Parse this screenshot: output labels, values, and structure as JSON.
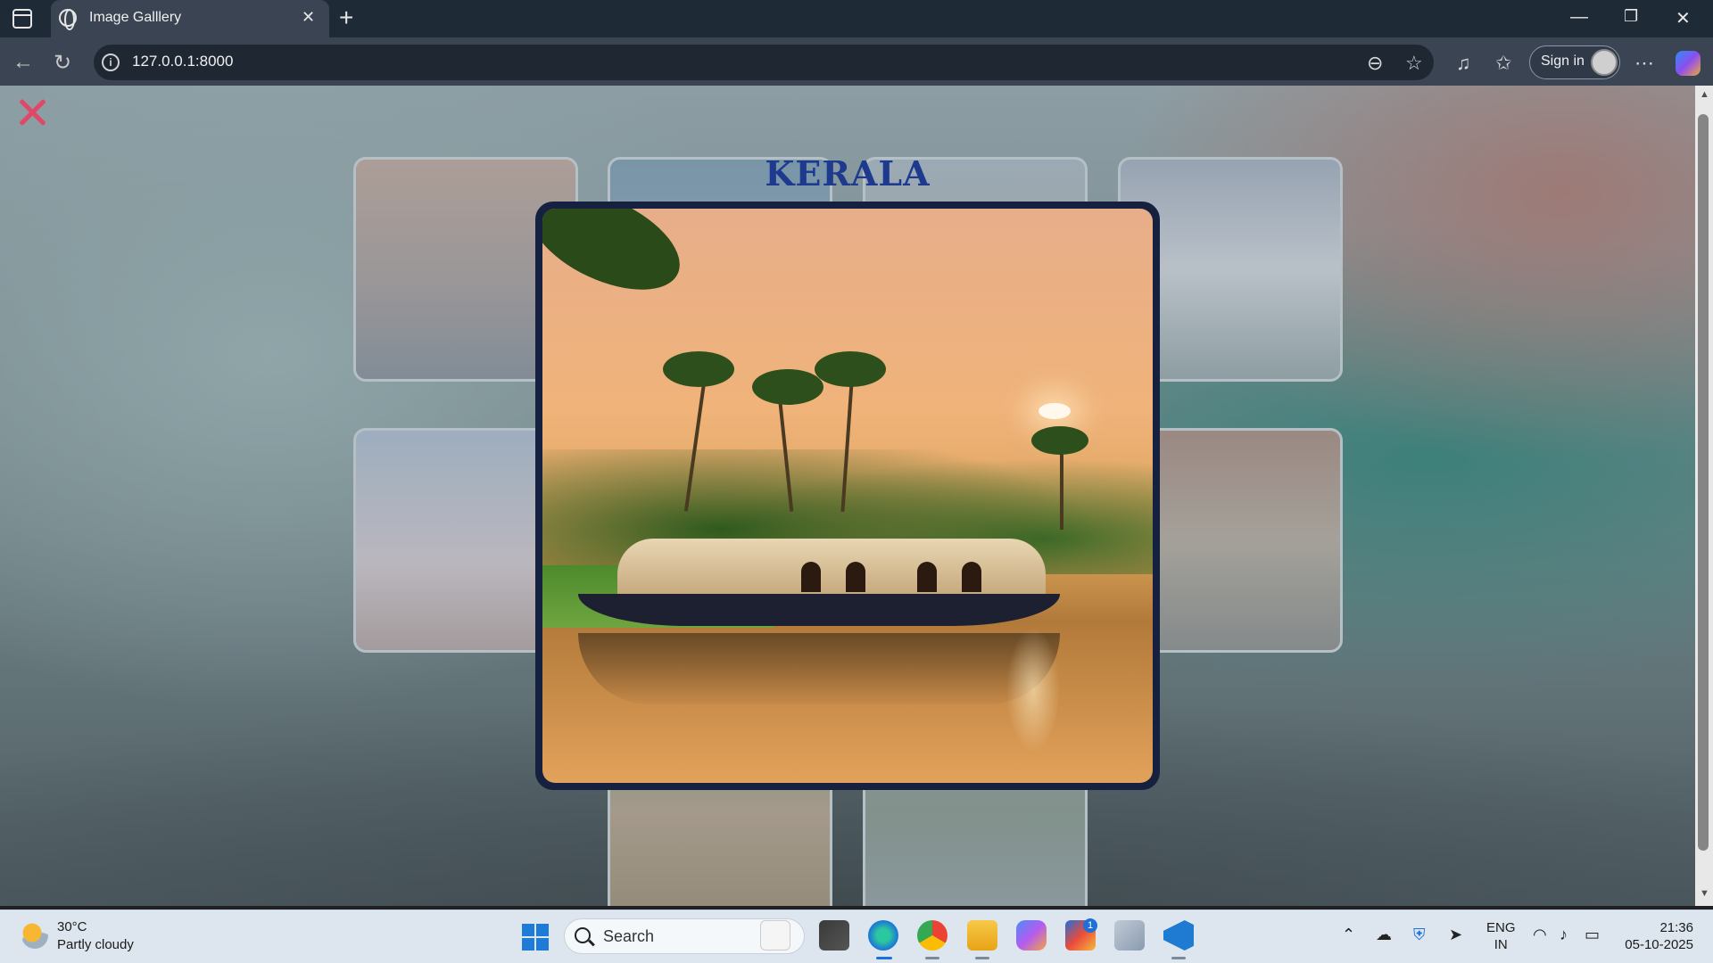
{
  "browser": {
    "tab_title": "Image Galllery",
    "url": "127.0.0.1:8000",
    "sign_in_label": "Sign in"
  },
  "modal": {
    "title": "KERALA",
    "image_icon": "houseboat-backwaters-image"
  },
  "gallery": {
    "thumbnails": [
      "varanasi-ghats",
      "backwaters",
      "temple",
      "lotus-temple",
      "statue-of-unity",
      "hawa-mahal",
      "kerala-houseboat",
      "taj-mahal"
    ]
  },
  "taskbar": {
    "weather_temp": "30°C",
    "weather_desc": "Partly cloudy",
    "search_placeholder": "Search",
    "store_badge": "1",
    "lang_line1": "ENG",
    "lang_line2": "IN",
    "time": "21:36",
    "date": "05-10-2025"
  },
  "colors": {
    "modal_title": "#1e3a8f",
    "modal_border": "#16203f",
    "close_x": "#e04868"
  }
}
